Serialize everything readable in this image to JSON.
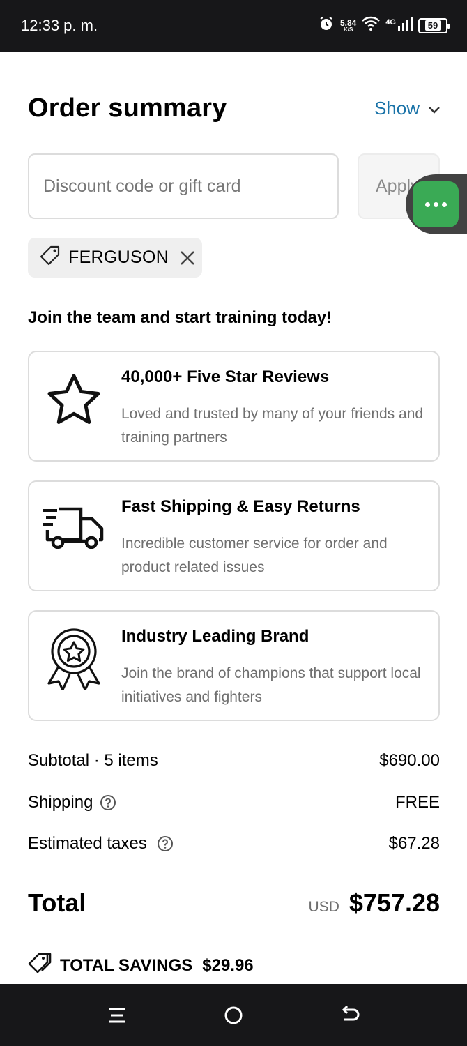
{
  "status_bar": {
    "time": "12:33 p. m.",
    "net_speed_value": "5.84",
    "net_speed_unit": "K/S",
    "network_type": "4G",
    "battery": "59"
  },
  "header": {
    "title": "Order summary",
    "show_label": "Show"
  },
  "discount": {
    "placeholder": "Discount code or gift card",
    "value": "",
    "apply_label": "Apply"
  },
  "applied_code": {
    "code": "FERGUSON"
  },
  "promo": {
    "heading": "Join the team and start training today!",
    "cards": [
      {
        "icon": "star-icon",
        "title": "40,000+ Five Star Reviews",
        "description": "Loved and trusted by many of your friends and training partners"
      },
      {
        "icon": "truck-icon",
        "title": "Fast Shipping & Easy Returns",
        "description": "Incredible customer service for order and product related issues"
      },
      {
        "icon": "award-ribbon-icon",
        "title": "Industry Leading Brand",
        "description": "Join the brand of champions that support local initiatives and fighters"
      }
    ]
  },
  "summary": {
    "subtotal_label": "Subtotal · 5 items",
    "subtotal_value": "$690.00",
    "shipping_label": "Shipping",
    "shipping_value": "FREE",
    "taxes_label": "Estimated taxes",
    "taxes_value": "$67.28",
    "total_label": "Total",
    "currency": "USD",
    "total_value": "$757.28",
    "savings_label": "TOTAL SAVINGS",
    "savings_value": "$29.96"
  },
  "colors": {
    "accent_link": "#1a73a8",
    "chat_green": "#3aaa55",
    "system_bar": "#171719"
  }
}
